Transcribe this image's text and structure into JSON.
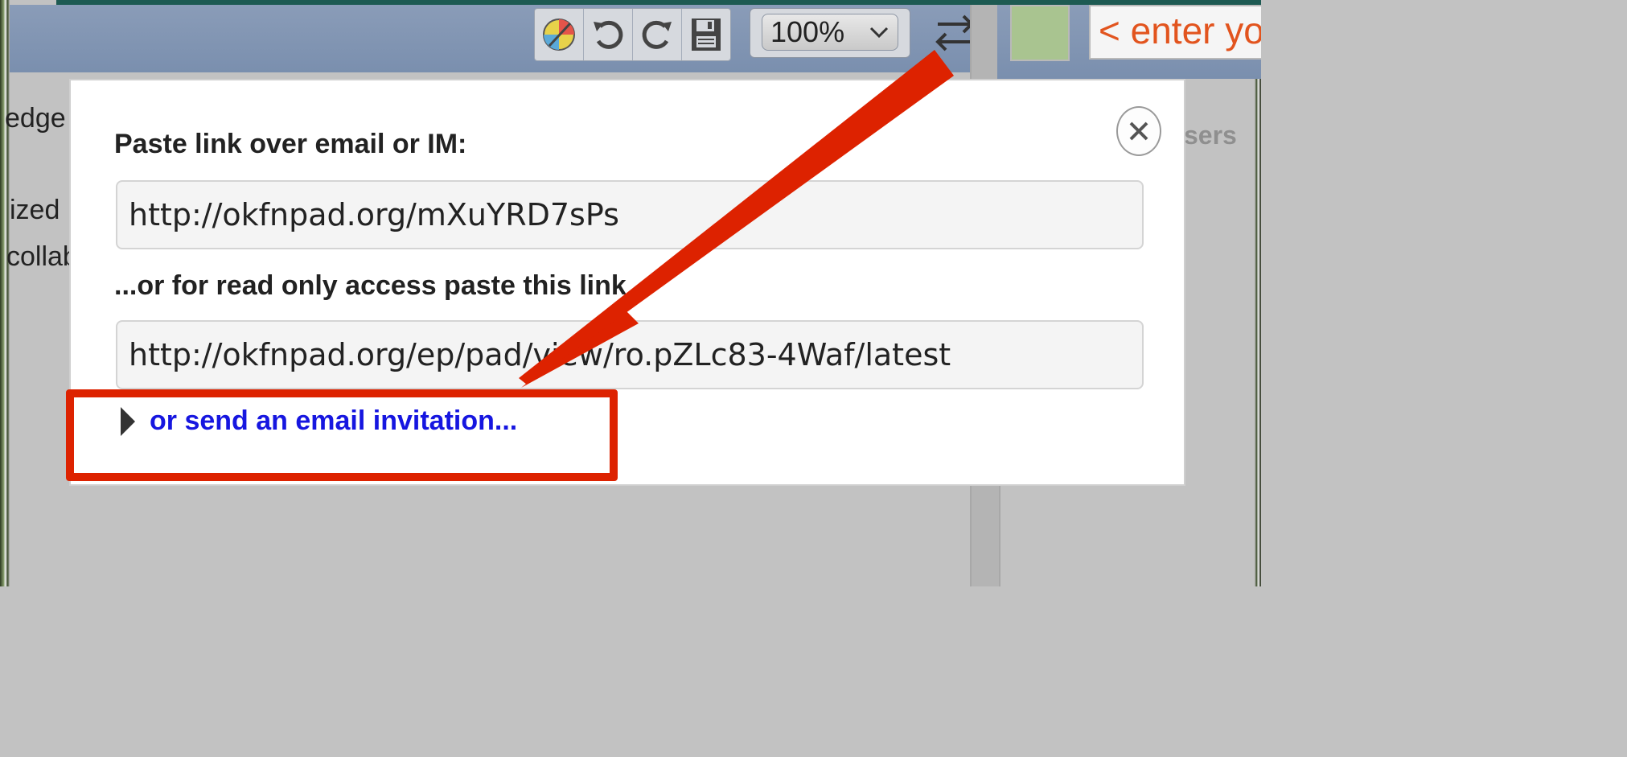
{
  "toolbar": {
    "buttons": [
      {
        "name": "color-icon"
      },
      {
        "name": "undo-icon"
      },
      {
        "name": "redo-icon"
      },
      {
        "name": "save-icon"
      }
    ],
    "zoom": "100%",
    "swap_icon": "swap-arrows-icon"
  },
  "user_panel": {
    "color": "#a9c490",
    "name_placeholder": "< enter yo",
    "users_label": "sers"
  },
  "background_text": {
    "line1": "edge",
    "line2": "ized",
    "line3": "collab"
  },
  "dialog": {
    "label_link": "Paste link over email or IM:",
    "link_value": "http://okfnpad.org/mXuYRD7sPs",
    "label_readonly": "...or for read only access paste this link",
    "readonly_value": "http://okfnpad.org/ep/pad/view/ro.pZLc83-4Waf/latest",
    "invite_link": "or send an email invitation..."
  },
  "annotation": {
    "color": "#dd2200"
  }
}
